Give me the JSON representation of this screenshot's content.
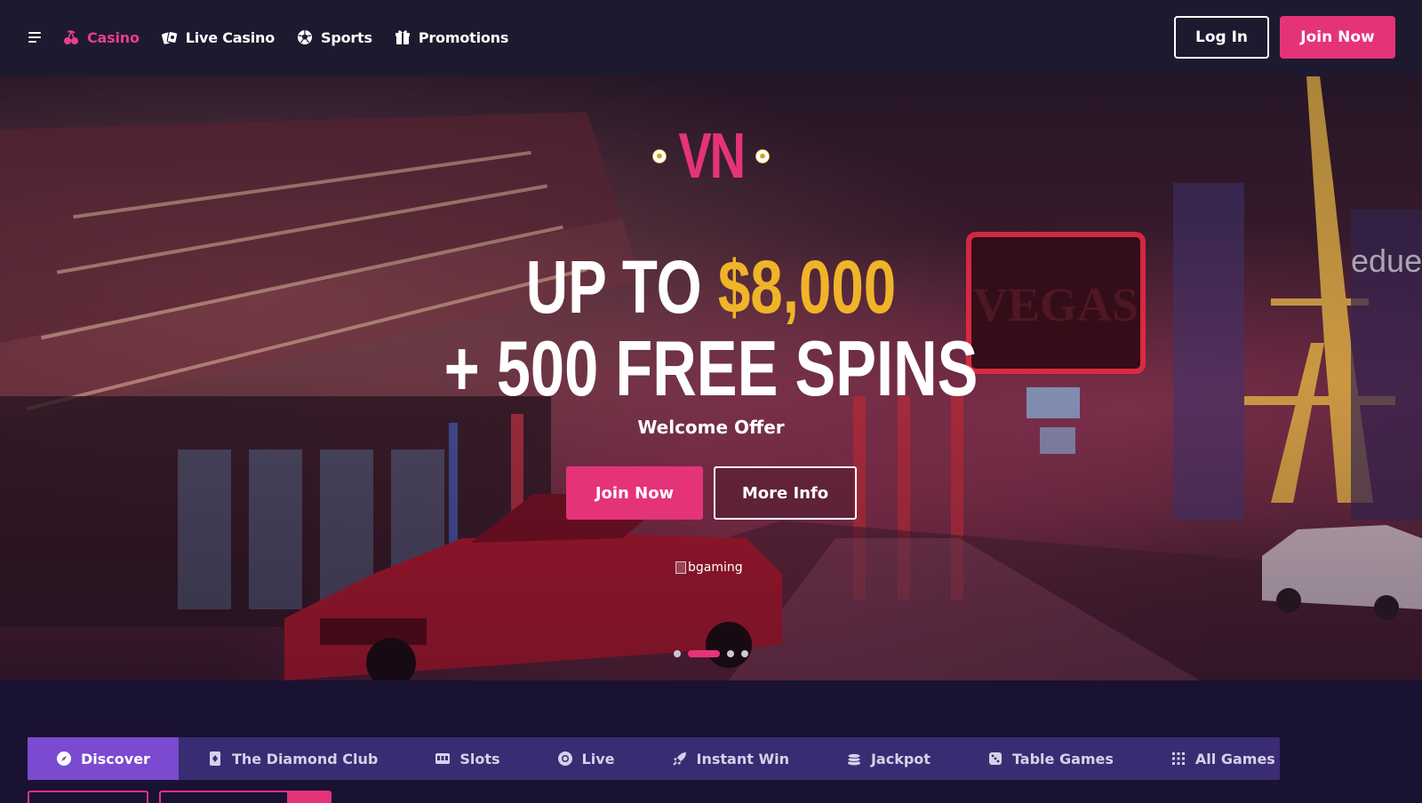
{
  "header": {
    "nav": [
      {
        "label": "Casino",
        "icon": "cherries-icon",
        "active": true
      },
      {
        "label": "Live Casino",
        "icon": "cards-icon",
        "active": false
      },
      {
        "label": "Sports",
        "icon": "soccer-ball-icon",
        "active": false
      },
      {
        "label": "Promotions",
        "icon": "gift-icon",
        "active": false
      }
    ],
    "login_label": "Log In",
    "join_label": "Join Now"
  },
  "hero": {
    "logo_text": "VN",
    "headline_prefix": "UP TO ",
    "headline_amount": "$8,000",
    "headline_line2": "+ 500 FREE SPINS",
    "subtitle": "Welcome Offer",
    "join_label": "Join Now",
    "more_info_label": "More Info",
    "provider_alt": "bgaming",
    "slides_total": 4,
    "active_slide": 2
  },
  "categories": [
    {
      "label": "Discover",
      "icon": "compass-icon",
      "active": true
    },
    {
      "label": "The Diamond Club",
      "icon": "diamond-card-icon",
      "active": false
    },
    {
      "label": "Slots",
      "icon": "slot-machine-icon",
      "active": false
    },
    {
      "label": "Live",
      "icon": "chip-icon",
      "active": false
    },
    {
      "label": "Instant Win",
      "icon": "rocket-icon",
      "active": false
    },
    {
      "label": "Jackpot",
      "icon": "coins-icon",
      "active": false
    },
    {
      "label": "Table Games",
      "icon": "dice-icon",
      "active": false
    },
    {
      "label": "All Games",
      "icon": "grid-icon",
      "active": false
    }
  ],
  "colors": {
    "accent": "#e5337a",
    "gold": "#f0b429",
    "header_bg": "#1d1a2f",
    "category_bg": "#3a2c72",
    "category_active": "#7a4ad0"
  }
}
